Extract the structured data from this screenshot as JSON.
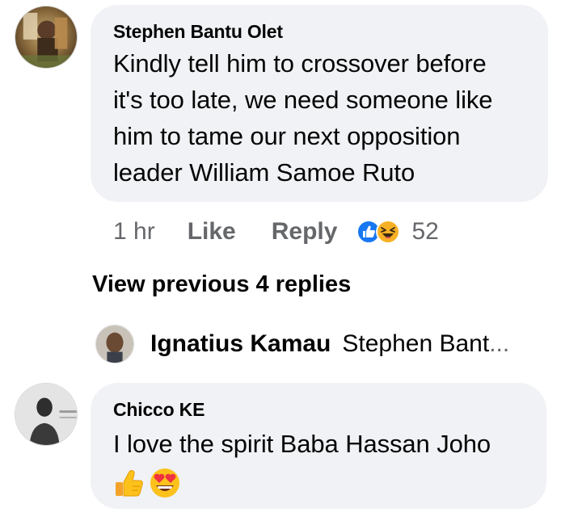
{
  "comment1": {
    "author": "Stephen Bantu Olet",
    "text": "Kindly tell him to crossover before\nit's too late, we need someone like\nhim to tame our next opposition\nleader William Samoe Ruto",
    "time": "1 hr",
    "like_label": "Like",
    "reply_label": "Reply",
    "reaction_icons": [
      "like-reaction-icon",
      "haha-reaction-icon"
    ],
    "reaction_count": "52"
  },
  "view_previous": "View previous 4 replies",
  "reply_preview": {
    "author": "Ignatius Kamau",
    "text": "Stephen Bant",
    "ellipsis": "..."
  },
  "comment2": {
    "author": "Chicco KE",
    "text": "I love the spirit Baba Hassan Joho",
    "emojis": [
      "thumbs-up-emoji",
      "heart-eyes-emoji"
    ]
  },
  "colors": {
    "bubble": "#f0f2f5",
    "muted": "#65676b",
    "text": "#050505",
    "like_blue": "#1877f2",
    "haha_yellow": "#f7b125"
  }
}
